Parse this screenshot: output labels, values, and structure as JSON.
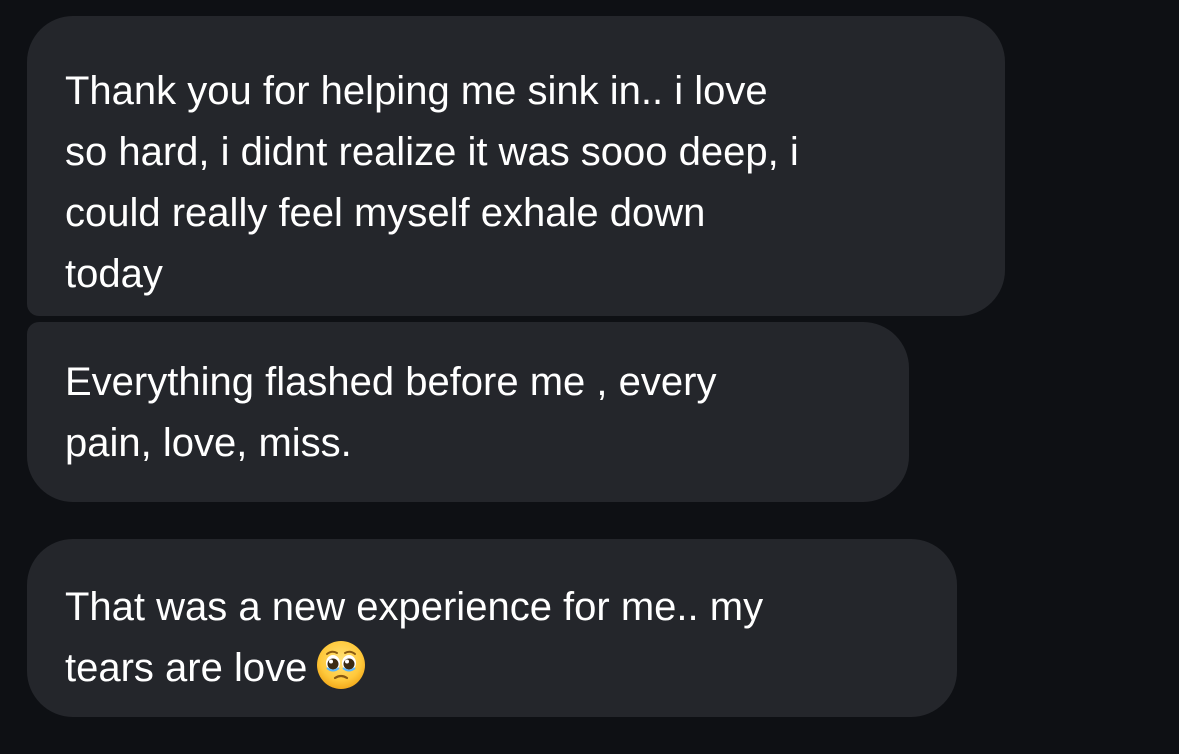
{
  "messages": [
    {
      "lines": [
        "Thank you for helping me sink in.. i love",
        "so hard, i didnt realize it was sooo deep, i",
        "could really feel myself exhale down",
        "today"
      ]
    },
    {
      "lines": [
        "Everything flashed before me , every",
        "pain, love, miss."
      ]
    },
    {
      "lines": [
        "That was a new experience for me.. my",
        "tears are love"
      ],
      "emoji": "pleading-face-icon"
    }
  ],
  "colors": {
    "background": "#0e1014",
    "bubble": "#24262b",
    "text": "#ffffff"
  }
}
